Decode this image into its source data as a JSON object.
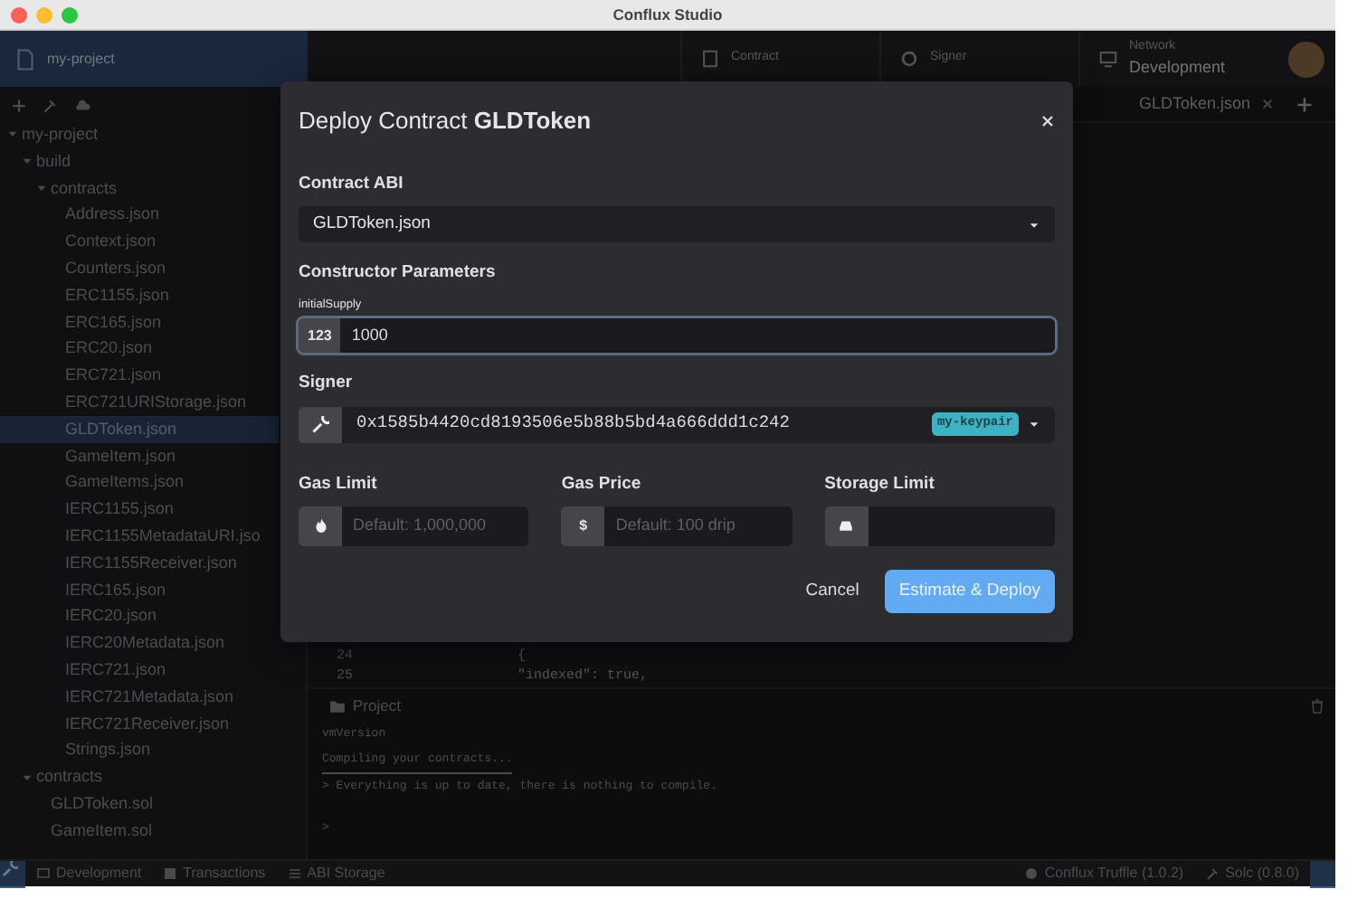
{
  "window": {
    "title": "Conflux Studio"
  },
  "header": {
    "project": "my-project",
    "toolbar": [
      {
        "label": "Contract",
        "kind": "contract"
      },
      {
        "label": "Signer",
        "kind": "signer"
      },
      {
        "label": "Network",
        "value": "Development",
        "kind": "network"
      }
    ]
  },
  "sidebar": {
    "tree": [
      {
        "label": "my-project",
        "expanded": true,
        "selected": false,
        "children": [
          {
            "label": "build",
            "expanded": true,
            "selected": false,
            "children": [
              {
                "label": "contracts",
                "expanded": true,
                "selected": false,
                "children": [
                  {
                    "label": "Address.json",
                    "selected": false
                  },
                  {
                    "label": "Context.json",
                    "selected": false
                  },
                  {
                    "label": "Counters.json",
                    "selected": false
                  },
                  {
                    "label": "ERC1155.json",
                    "selected": false
                  },
                  {
                    "label": "ERC165.json",
                    "selected": false
                  },
                  {
                    "label": "ERC20.json",
                    "selected": false
                  },
                  {
                    "label": "ERC721.json",
                    "selected": false
                  },
                  {
                    "label": "ERC721URIStorage.json",
                    "selected": false
                  },
                  {
                    "label": "GLDToken.json",
                    "selected": true
                  },
                  {
                    "label": "GameItem.json",
                    "selected": false
                  },
                  {
                    "label": "GameItems.json",
                    "selected": false
                  },
                  {
                    "label": "IERC1155.json",
                    "selected": false
                  },
                  {
                    "label": "IERC1155MetadataURI.jso",
                    "selected": false
                  },
                  {
                    "label": "IERC1155Receiver.json",
                    "selected": false
                  },
                  {
                    "label": "IERC165.json",
                    "selected": false
                  },
                  {
                    "label": "IERC20.json",
                    "selected": false
                  },
                  {
                    "label": "IERC20Metadata.json",
                    "selected": false
                  },
                  {
                    "label": "IERC721.json",
                    "selected": false
                  },
                  {
                    "label": "IERC721Metadata.json",
                    "selected": false
                  },
                  {
                    "label": "IERC721Receiver.json",
                    "selected": false
                  },
                  {
                    "label": "Strings.json",
                    "selected": false
                  }
                ]
              }
            ]
          },
          {
            "label": "contracts",
            "expanded": true,
            "selected": false,
            "children": [
              {
                "label": "GLDToken.sol",
                "selected": false
              },
              {
                "label": "GameItem.sol",
                "selected": false
              }
            ]
          }
        ]
      }
    ]
  },
  "editor": {
    "tab": "GLDToken.json",
    "lines": [
      {
        "number": "24",
        "code": "{"
      },
      {
        "number": "25",
        "code": "\"indexed\": true,"
      }
    ]
  },
  "terminal": {
    "tab": "Project",
    "lines": [
      {
        "text": "vmVersion",
        "kind": "plain"
      },
      {
        "text": "Compiling your contracts...",
        "kind": "underlined"
      },
      {
        "text": "> Everything is up to date, there is nothing to compile.",
        "kind": "plain"
      },
      {
        "text": ">",
        "kind": "prompt"
      }
    ]
  },
  "status_bar": {
    "left": [
      {
        "label": "Development",
        "kind": "network"
      },
      {
        "label": "Transactions",
        "kind": "transactions"
      },
      {
        "label": "ABI Storage",
        "kind": "list"
      }
    ],
    "right": [
      {
        "label": "Conflux Truffle (1.0.2)",
        "kind": "truffle"
      },
      {
        "label": "Solc (0.8.0)",
        "kind": "solc"
      }
    ]
  },
  "modal": {
    "title": "Deploy Contract **GLDToken**",
    "contract_abi": {
      "label": "Contract ABI",
      "value": "GLDToken.json"
    },
    "constructor": {
      "label": "Constructor Parameters",
      "params": [
        {
          "name": "initialSupply",
          "addon": "123",
          "value": "1000",
          "focused": true
        }
      ]
    },
    "signer": {
      "label": "Signer",
      "address": "0x1585b4420cd8193506e5b88b5bd4a666ddd1c242",
      "badge": "my-keypair"
    },
    "gas_fields": [
      {
        "label": "Gas Limit",
        "kind": "fire",
        "placeholder": "Default: 1,000,000"
      },
      {
        "label": "Gas Price",
        "kind": "text",
        "addon": "$",
        "placeholder": "Default: 100 drip"
      },
      {
        "label": "Storage Limit",
        "kind": "drive"
      }
    ],
    "buttons": [
      {
        "label": "Cancel",
        "kind": "link"
      },
      {
        "label": "Estimate & Deploy",
        "kind": "primary"
      }
    ]
  }
}
